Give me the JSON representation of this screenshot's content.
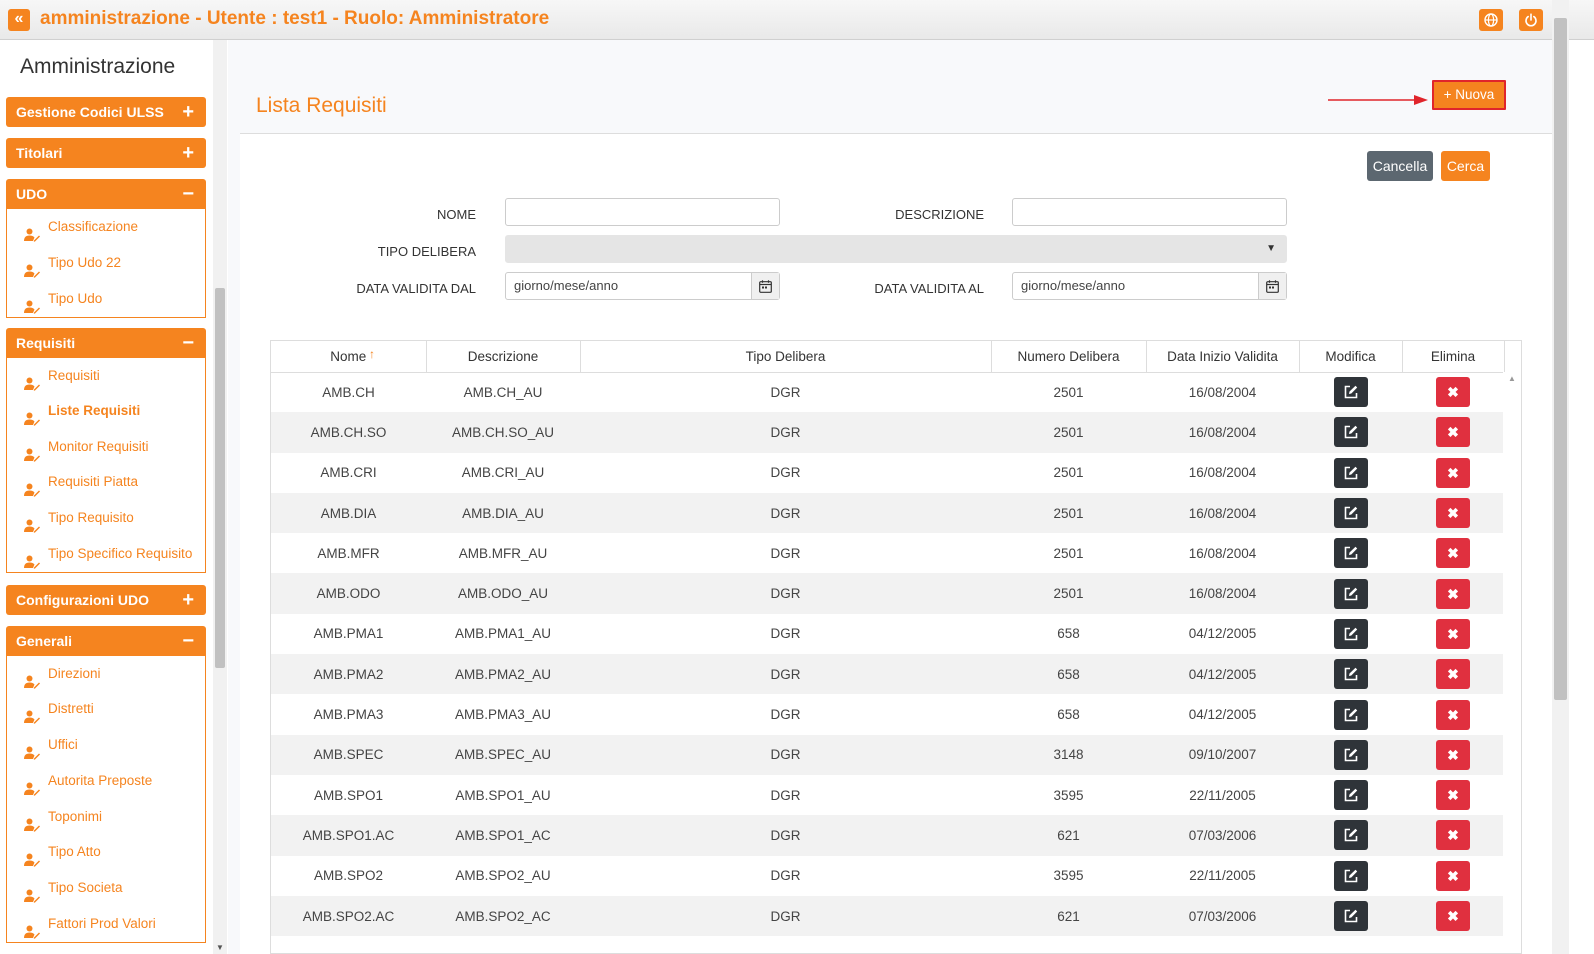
{
  "header": {
    "title": "amministrazione - Utente : test1 - Ruolo: Amministratore",
    "collapse_glyph": "«",
    "accent": "#f5841f",
    "icons": [
      "globe-icon",
      "power-icon"
    ]
  },
  "sidebar": {
    "title": "Amministrazione",
    "sections": [
      {
        "label": "Gestione Codici ULSS",
        "sign": "+"
      },
      {
        "label": "Titolari",
        "sign": "+"
      },
      {
        "label": "UDO",
        "sign": "−",
        "items": [
          "Classificazione",
          "Tipo Udo 22",
          "Tipo Udo"
        ]
      },
      {
        "label": "Requisiti",
        "sign": "−",
        "items": [
          "Requisiti",
          "Liste Requisiti",
          "Monitor Requisiti",
          "Requisiti Piatta",
          "Tipo Requisito",
          "Tipo Specifico Requisito"
        ]
      },
      {
        "label": "Configurazioni UDO",
        "sign": "+"
      },
      {
        "label": "Generali",
        "sign": "−",
        "items": [
          "Direzioni",
          "Distretti",
          "Uffici",
          "Autorita Preposte",
          "Toponimi",
          "Tipo Atto",
          "Tipo Societa",
          "Fattori Prod Valori"
        ]
      }
    ],
    "active_item": "Liste Requisiti"
  },
  "page": {
    "title": "Lista Requisiti",
    "new_button": "Nuova",
    "cancel_button": "Cancella",
    "search_button": "Cerca"
  },
  "filters": {
    "nome_label": "NOME",
    "descrizione_label": "DESCRIZIONE",
    "tipo_delibera_label": "TIPO DELIBERA",
    "data_dal_label": "DATA VALIDITA DAL",
    "data_al_label": "DATA VALIDITA AL",
    "data_dal_value": "giorno/mese/anno",
    "data_al_value": "giorno/mese/anno"
  },
  "table": {
    "columns": [
      "Nome",
      "Descrizione",
      "Tipo Delibera",
      "Numero Delibera",
      "Data Inizio Validita",
      "Modifica",
      "Elimina"
    ],
    "sort_glyph": "↑",
    "delete_glyph": "✖",
    "rows": [
      [
        "AMB.CH",
        "AMB.CH_AU",
        "DGR",
        "2501",
        "16/08/2004"
      ],
      [
        "AMB.CH.SO",
        "AMB.CH.SO_AU",
        "DGR",
        "2501",
        "16/08/2004"
      ],
      [
        "AMB.CRI",
        "AMB.CRI_AU",
        "DGR",
        "2501",
        "16/08/2004"
      ],
      [
        "AMB.DIA",
        "AMB.DIA_AU",
        "DGR",
        "2501",
        "16/08/2004"
      ],
      [
        "AMB.MFR",
        "AMB.MFR_AU",
        "DGR",
        "2501",
        "16/08/2004"
      ],
      [
        "AMB.ODO",
        "AMB.ODO_AU",
        "DGR",
        "2501",
        "16/08/2004"
      ],
      [
        "AMB.PMA1",
        "AMB.PMA1_AU",
        "DGR",
        "658",
        "04/12/2005"
      ],
      [
        "AMB.PMA2",
        "AMB.PMA2_AU",
        "DGR",
        "658",
        "04/12/2005"
      ],
      [
        "AMB.PMA3",
        "AMB.PMA3_AU",
        "DGR",
        "658",
        "04/12/2005"
      ],
      [
        "AMB.SPEC",
        "AMB.SPEC_AU",
        "DGR",
        "3148",
        "09/10/2007"
      ],
      [
        "AMB.SPO1",
        "AMB.SPO1_AU",
        "DGR",
        "3595",
        "22/11/2005"
      ],
      [
        "AMB.SPO1.AC",
        "AMB.SPO1_AC",
        "DGR",
        "621",
        "07/03/2006"
      ],
      [
        "AMB.SPO2",
        "AMB.SPO2_AU",
        "DGR",
        "3595",
        "22/11/2005"
      ],
      [
        "AMB.SPO2.AC",
        "AMB.SPO2_AC",
        "DGR",
        "621",
        "07/03/2006"
      ]
    ]
  }
}
